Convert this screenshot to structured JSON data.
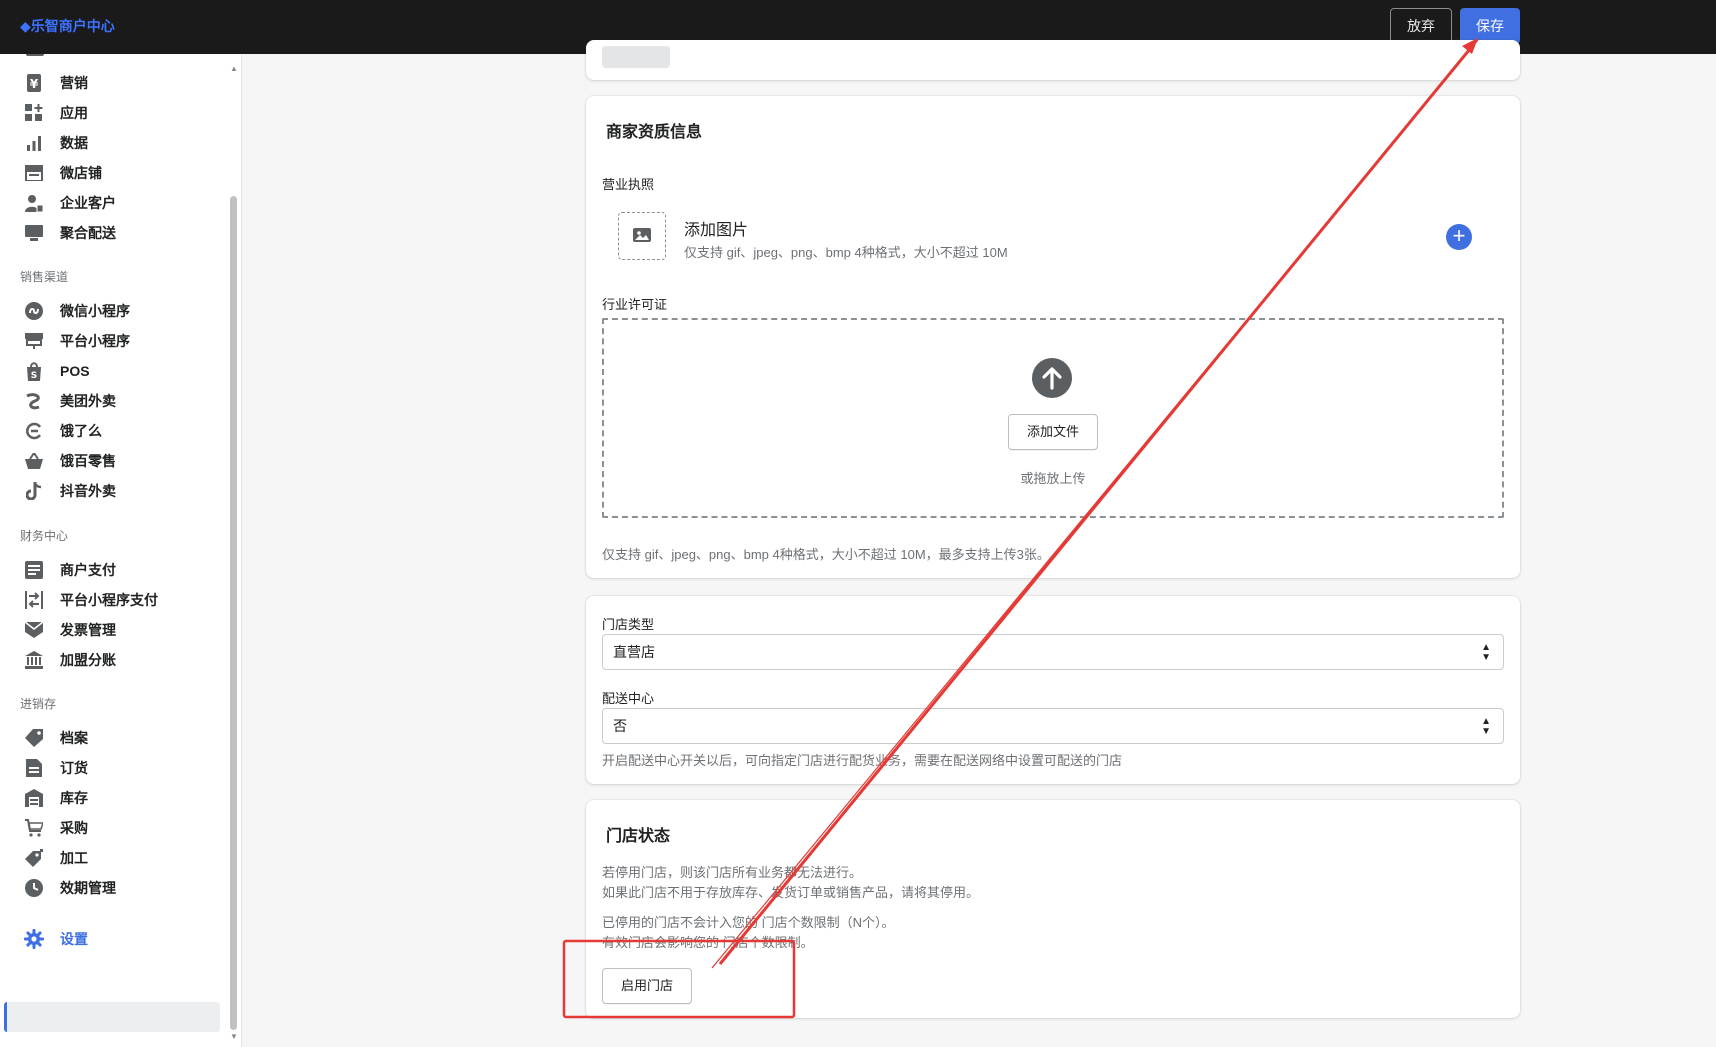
{
  "header": {
    "brand": "乐智商户中心",
    "discard_label": "放弃",
    "save_label": "保存"
  },
  "sidebar": {
    "top_items": [
      {
        "label": "营销",
        "icon": "yen-icon"
      },
      {
        "label": "应用",
        "icon": "apps-icon"
      },
      {
        "label": "数据",
        "icon": "bar-chart-icon"
      },
      {
        "label": "微店铺",
        "icon": "storefront-icon"
      },
      {
        "label": "企业客户",
        "icon": "business-customer-icon"
      },
      {
        "label": "聚合配送",
        "icon": "monitor-icon"
      }
    ],
    "sales_title": "销售渠道",
    "sales_items": [
      {
        "label": "微信小程序",
        "icon": "mini-program-icon"
      },
      {
        "label": "平台小程序",
        "icon": "platform-store-icon"
      },
      {
        "label": "POS",
        "icon": "pos-bag-icon"
      },
      {
        "label": "美团外卖",
        "icon": "meituan-icon"
      },
      {
        "label": "饿了么",
        "icon": "eleme-icon"
      },
      {
        "label": "饿百零售",
        "icon": "basket-icon"
      },
      {
        "label": "抖音外卖",
        "icon": "tiktok-icon"
      }
    ],
    "finance_title": "财务中心",
    "finance_items": [
      {
        "label": "商户支付",
        "icon": "payment-doc-icon"
      },
      {
        "label": "平台小程序支付",
        "icon": "transfer-icon"
      },
      {
        "label": "发票管理",
        "icon": "invoice-icon"
      },
      {
        "label": "加盟分账",
        "icon": "bank-icon"
      }
    ],
    "inventory_title": "进销存",
    "inventory_items": [
      {
        "label": "档案",
        "icon": "tag-icon"
      },
      {
        "label": "订货",
        "icon": "order-doc-icon"
      },
      {
        "label": "库存",
        "icon": "warehouse-icon"
      },
      {
        "label": "采购",
        "icon": "cart-icon"
      },
      {
        "label": "加工",
        "icon": "process-tag-icon"
      },
      {
        "label": "效期管理",
        "icon": "clock-icon"
      }
    ],
    "settings_label": "设置"
  },
  "qualification": {
    "title": "商家资质信息",
    "license_label": "营业执照",
    "add_image_title": "添加图片",
    "add_image_hint": "仅支持 gif、jpeg、png、bmp 4种格式，大小不超过 10M",
    "industry_label": "行业许可证",
    "add_file_label": "添加文件",
    "drag_hint": "或拖放上传",
    "upload_note": "仅支持 gif、jpeg、png、bmp 4种格式，大小不超过 10M，最多支持上传3张。"
  },
  "store_type": {
    "type_label": "门店类型",
    "type_value": "直营店",
    "delivery_label": "配送中心",
    "delivery_value": "否",
    "delivery_note": "开启配送中心开关以后，可向指定门店进行配货业务，需要在配送网络中设置可配送的门店"
  },
  "store_status": {
    "title": "门店状态",
    "line1": "若停用门店，则该门店所有业务都无法进行。",
    "line2": "如果此门店不用于存放库存、发货订单或销售产品，请将其停用。",
    "line3": "已停用的门店不会计入您的 门店个数限制（N个）。",
    "line4": "有效门店会影响您的 门店个数限制。",
    "enable_button": "启用门店"
  },
  "colors": {
    "accent": "#3f6fe0",
    "topbar": "#1a1a1a",
    "annotation": "#e53935"
  }
}
